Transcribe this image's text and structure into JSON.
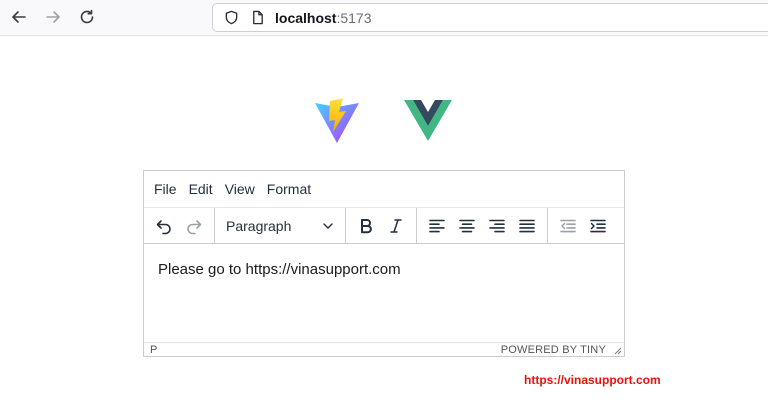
{
  "browser": {
    "url_host": "localhost",
    "url_port": ":5173"
  },
  "logos": {
    "vite": {
      "name": "Vite logo",
      "colors": {
        "purple": "#a259ff",
        "blue": "#41d1ff",
        "yellow": "#ffdd35",
        "orange": "#ff9d2b"
      }
    },
    "vue": {
      "name": "Vue logo",
      "colors": {
        "green": "#41b883",
        "dark": "#35495e"
      }
    }
  },
  "editor": {
    "menu": [
      "File",
      "Edit",
      "View",
      "Format"
    ],
    "block_format": "Paragraph",
    "content": "Please go to  https://vinasupport.com",
    "status_path": "P",
    "branding": "POWERED BY TINY"
  },
  "watermark": "https://vinasupport.com",
  "colors": {
    "watermark": "#e8120b",
    "toolbar_icon": "#222f3e"
  }
}
